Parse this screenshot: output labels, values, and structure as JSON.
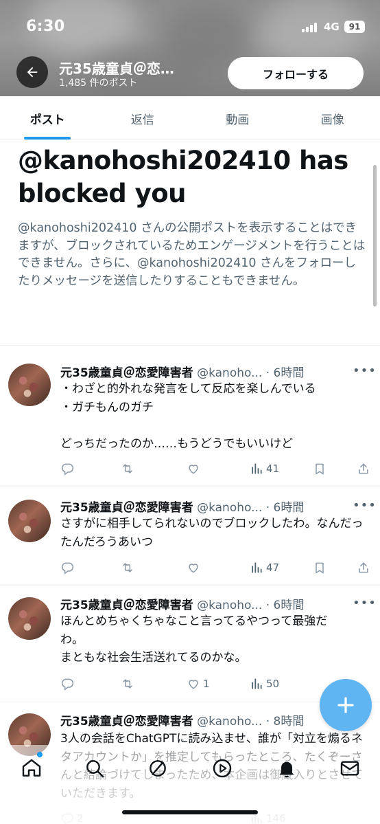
{
  "status_bar": {
    "time": "6:30",
    "network": "4G",
    "battery": "91"
  },
  "header": {
    "name": "元35歳童貞＠恋…",
    "post_count": "1,485 件のポスト",
    "follow_label": "フォローする"
  },
  "tabs": [
    {
      "label": "ポスト",
      "active": true
    },
    {
      "label": "返信",
      "active": false
    },
    {
      "label": "動画",
      "active": false
    },
    {
      "label": "画像",
      "active": false
    }
  ],
  "blocked": {
    "title": "@kanohoshi202410 has blocked you",
    "description": "@kanohoshi202410 さんの公開ポストを表示することはできますが、ブロックされているためエンゲージメントを行うことはできません。さらに、@kanohoshi202410 さんをフォローしたりメッセージを送信したりすることもできません。"
  },
  "posts": [
    {
      "author": "元35歳童貞＠恋愛障害者",
      "handle": "@kanoho...",
      "time": "6時間",
      "text": "・わざと的外れな発言をして反応を楽しんでいる\n・ガチもんのガチ\n\nどっちだったのか……もうどうでもいいけど",
      "views": "41",
      "likes": ""
    },
    {
      "author": "元35歳童貞＠恋愛障害者",
      "handle": "@kanoho...",
      "time": "6時間",
      "text": "さすがに相手してられないのでブロックしたわ。なんだったんだろうあいつ",
      "views": "47",
      "likes": ""
    },
    {
      "author": "元35歳童貞＠恋愛障害者",
      "handle": "@kanoho...",
      "time": "6時間",
      "text": "ほんとめちゃくちゃなこと言ってるやつって最強だわ。\nまともな社会生活送れてるのかな。",
      "views": "50",
      "likes": "1"
    },
    {
      "author": "元35歳童貞＠恋愛障害者",
      "handle": "@kanoho...",
      "time": "8時間",
      "text": "3人の会話をChatGPTに読み込ませ、誰が「対立を煽るネタアカウントか」を推定してもらったところ、たくぞーさんと結論づけてしまったため、本企画は御蔵入りとさせていただきます。",
      "views": "146",
      "replies": "2"
    }
  ],
  "icons": {
    "back": "arrow-left-icon",
    "more": "more-icon",
    "reply": "reply-icon",
    "repost": "repost-icon",
    "like": "heart-icon",
    "views": "views-icon",
    "bookmark": "bookmark-icon",
    "share": "share-icon",
    "compose": "plus-icon"
  },
  "colors": {
    "accent": "#1d9bf0",
    "muted": "#536471",
    "text": "#0f1419"
  }
}
